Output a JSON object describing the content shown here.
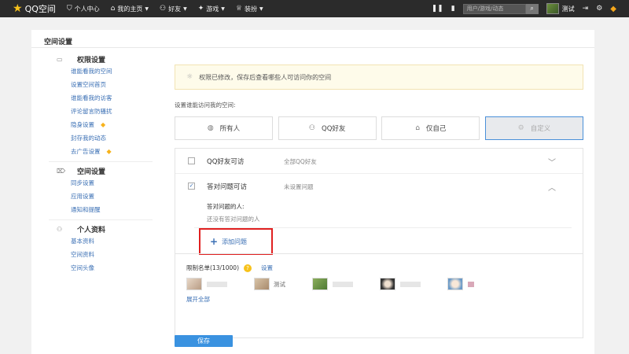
{
  "topbar": {
    "logo": "QQ空间",
    "nav": [
      {
        "icon": "user-icon",
        "label": "个人中心",
        "caret": false
      },
      {
        "icon": "home-icon",
        "label": "我的主页",
        "caret": true
      },
      {
        "icon": "friends-icon",
        "label": "好友",
        "caret": true
      },
      {
        "icon": "game-icon",
        "label": "游戏",
        "caret": true
      },
      {
        "icon": "dress-icon",
        "label": "装扮",
        "caret": true
      }
    ],
    "search_placeholder": "用户/游戏/动态",
    "username": "测试"
  },
  "page_title": "空间设置",
  "sidebar": {
    "sections": [
      {
        "title": "权限设置",
        "items": [
          "谁能看我的空间",
          "设置空间首页",
          "谁能看我的访客",
          "评论留言防骚扰",
          "隐身设置",
          "封存我的动态",
          "去广告设置"
        ]
      },
      {
        "title": "空间设置",
        "items": [
          "同步设置",
          "应用设置",
          "通知和提醒"
        ]
      },
      {
        "title": "个人资料",
        "items": [
          "基本资料",
          "空间资料",
          "空间头像"
        ]
      }
    ]
  },
  "notice": "权限已修改，保存后查看哪些人可访问你的空间",
  "who_label": "设置谁能访问我的空间:",
  "options": [
    {
      "label": "所有人",
      "icon": "globe-icon"
    },
    {
      "label": "QQ好友",
      "icon": "friends-icon"
    },
    {
      "label": "仅自己",
      "icon": "lock-icon"
    },
    {
      "label": "自定义",
      "icon": "gear-icon"
    }
  ],
  "rows": [
    {
      "title": "QQ好友可访",
      "sub": "全部QQ好友",
      "checked": false
    },
    {
      "title": "答对问题可访",
      "sub": "未设置问题",
      "checked": true
    }
  ],
  "question": {
    "label": "答对问题的人:",
    "empty": "还没有答对问题的人",
    "add": "添加问题"
  },
  "limit": {
    "label": "限制名单(13/1000)",
    "help": "?",
    "set": "设置",
    "friends": [
      {
        "name": ""
      },
      {
        "name": "测试"
      },
      {
        "name": ""
      },
      {
        "name": ""
      },
      {
        "name": ""
      }
    ],
    "expand": "展开全部"
  },
  "save": "保存"
}
